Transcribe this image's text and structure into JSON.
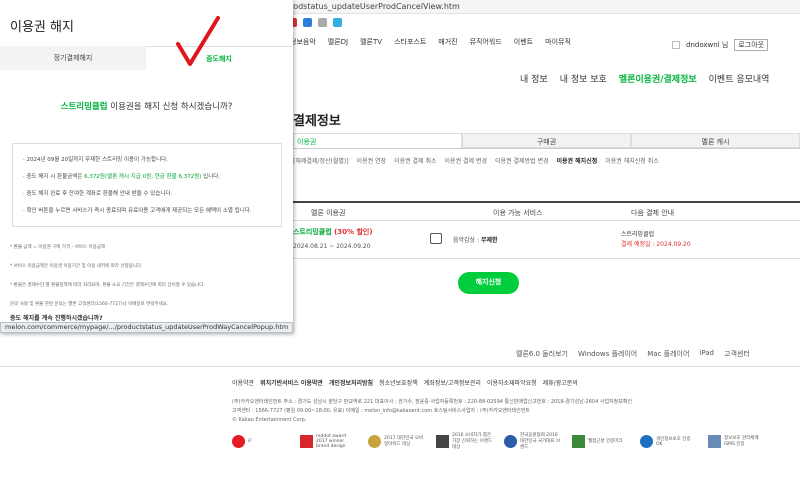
{
  "browser": {
    "url": "prodstatus_updateUserProdCancelView.htm",
    "status_url": "melon.com/commerce/mypage/.../productstatus_updateUserProdWayCancelPopup.htm"
  },
  "top_nav": [
    "정보음악",
    "멜론DJ",
    "멜론TV",
    "스타포스트",
    "매거진",
    "뮤직어워드",
    "이벤트",
    "마이뮤직"
  ],
  "user": {
    "name": "dndoxwnl 님",
    "login_button": "로그아웃"
  },
  "sub_nav": [
    "내 정보",
    "내 정보 보호",
    "멜론이용권/결제정보",
    "이벤트 응모내역"
  ],
  "page_heading": "결제정보",
  "tabs": [
    "이용권",
    "구매권",
    "멜론 캐시"
  ],
  "filters": [
    "이용권 연장",
    "이용권 결제 취소",
    "이용권 결제 변경",
    "이용권 결제방법 변경",
    "이용권 해지신청",
    "이용권 해지신청 취소"
  ],
  "filter_prefix": "[해제결제/정산(월별)]",
  "table": {
    "headers": [
      "멜론 이용권",
      "이용 가능 서비스",
      "다음 결제 안내"
    ],
    "row": {
      "name": "스트리밍클럽",
      "name_suffix": "(30% 할인)",
      "period": "2024.08.21 ~ 2024.09.20",
      "service_label": "음악감상 :",
      "service_value": "무제한",
      "payment_name": "스트리밍클럽",
      "payment_note": "결제 예정일 : 2024.09.20"
    }
  },
  "cancel_button": "해지신청",
  "footer_links": [
    "멜론6.0 둘러보기",
    "Windows 플레이어",
    "Mac 플레이어",
    "iPad",
    "고객센터"
  ],
  "legal_links": [
    {
      "label": "이용약관",
      "bold": false
    },
    {
      "label": "위치기반서비스 이용약관",
      "bold": true
    },
    {
      "label": "개인정보처리방침",
      "bold": true
    },
    {
      "label": "청소년보호정책",
      "bold": false
    },
    {
      "label": "계좌정보/고객정보관리",
      "bold": false
    },
    {
      "label": "이용자소재파악요청",
      "bold": false
    },
    {
      "label": "제휴/광고문의",
      "bold": false
    }
  ],
  "corp_lines": [
    "(주)카카오엔터테인먼트   주소 : 경기도 성남시 분당구 판교역로 221   대표이사 : 권기수, 장윤중   사업자등록번호 : 220-88-02594   통신판매업신고번호 : 2018-경기성남-2604   사업자정보확인",
    "고객센터 : 1566-7727 (평일 09:00~18:00, 유료)   이메일 : melon_info@kakaoent.com   호스팅서비스사업자 : (주)카카오엔터테인먼트",
    "© Kakao Entertainment Corp."
  ],
  "badges": [
    {
      "label": "iF",
      "color": "#e21c22"
    },
    {
      "label": "reddot award 2017 winner brand design",
      "color": "#d6262b"
    },
    {
      "label": "2017 대한민국 모바일어워드 대상",
      "color": "#c8a23b"
    },
    {
      "label": "2016 소비자가 뽑은 가장 신뢰하는 브랜드 대상",
      "color": "#444444"
    },
    {
      "label": "한국음원협회 2016 대한민국 국가대표 브랜드",
      "color": "#2c5da8"
    },
    {
      "label": "웹접근성 인증마크",
      "color": "#3a8a3a"
    },
    {
      "label": "개인정보보호 인증 OK",
      "color": "#1f6fc2"
    },
    {
      "label": "정보보호 관리체계 ISMS 인증",
      "color": "#6a8bb8"
    }
  ],
  "popup": {
    "title": "이용권 해지",
    "tabs": [
      "정기결제해지",
      "중도해지"
    ],
    "question_highlight": "스트리밍클럽",
    "question_rest": " 이용권을 해지 신청 하시겠습니까?",
    "info": [
      {
        "pre": "2024년 09월 20일까지 무제한 스트리밍 이용이 가능합니다.",
        "hi": "",
        "post": ""
      },
      {
        "pre": "중도 해지 시 환불금액은 ",
        "hi": "6,372원(멜론 캐시 지급 0원, 현금 환불 6,372원)",
        "post": " 입니다."
      },
      {
        "pre": "중도 해지 완료 후 잔여한 계좌로 환불해 안내 받을 수 있습니다.",
        "hi": "",
        "post": ""
      },
      {
        "pre": "확인 버튼을 누르면 서비스가 즉시 종료되며 유료이용 고객에게 제공되는 모든 혜택이 소멸 됩니다.",
        "hi": "",
        "post": ""
      }
    ],
    "notes": [
      "* 환불 금액 = 이용권 구매 가격 - 서비스 이용금액",
      "* 서비스 이용금액은 이용권 이용기간 및 이용 내역에 따라 산정됩니다.",
      "* 환불은 결제수단 별 환불정책에 따라 처리되며, 환불 소요 기간은 결제수단에 따라 상이할 수 있습니다.",
      "문의 사항 및 환불 관련 문의는 멜론 고객센터(1566-7727)나 이메일로 연락주세요."
    ],
    "cutoff_text": "중도 해지를 계속 진행하시겠습니까?"
  },
  "colors": {
    "accent": "#00b33c",
    "button": "#00cd3c",
    "alert": "#e03030"
  }
}
